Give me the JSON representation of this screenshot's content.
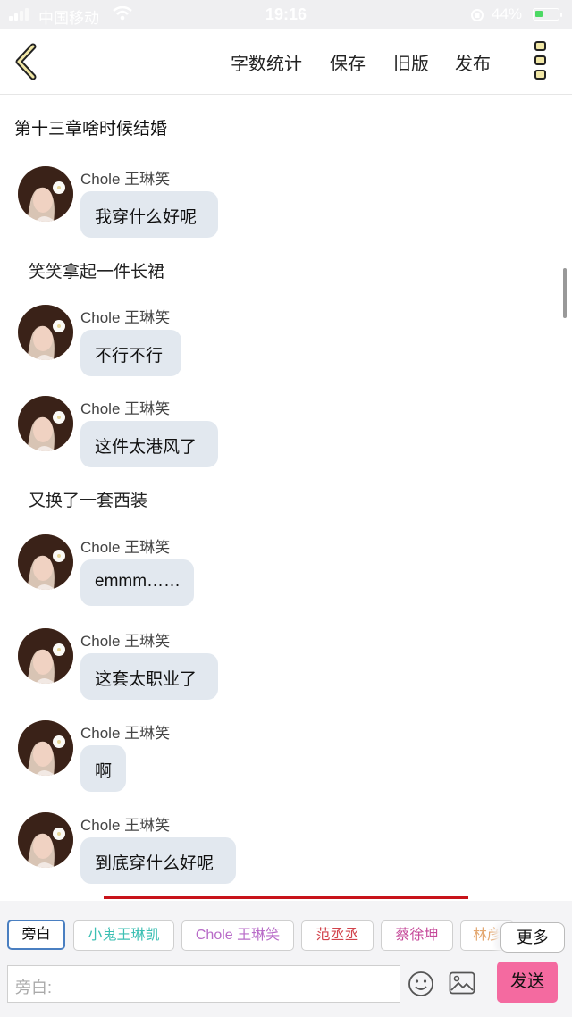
{
  "status_bar": {
    "carrier": "中国移动",
    "time": "19:16",
    "battery": "44%"
  },
  "toolbar": {
    "word_count": "字数统计",
    "save": "保存",
    "old_version": "旧版",
    "publish": "发布"
  },
  "chapter_title": "第十三章啥时候结婚",
  "messages": [
    {
      "type": "chat",
      "sender": "Chole 王琳笑",
      "text": "我穿什么好呢"
    },
    {
      "type": "narration",
      "text": "笑笑拿起一件长裙"
    },
    {
      "type": "chat",
      "sender": "Chole 王琳笑",
      "text": "不行不行"
    },
    {
      "type": "chat",
      "sender": "Chole 王琳笑",
      "text": "这件太港风了"
    },
    {
      "type": "narration",
      "text": "又换了一套西装"
    },
    {
      "type": "chat",
      "sender": "Chole 王琳笑",
      "text": "emmm……"
    },
    {
      "type": "chat",
      "sender": "Chole 王琳笑",
      "text": "这套太职业了"
    },
    {
      "type": "chat",
      "sender": "Chole 王琳笑",
      "text": "啊"
    },
    {
      "type": "chat",
      "sender": "Chole 王琳笑",
      "text": "到底穿什么好呢"
    }
  ],
  "roles": [
    {
      "label": "旁白",
      "color": "#111111",
      "selected": true
    },
    {
      "label": "小鬼王琳凯",
      "color": "#3bbfb3"
    },
    {
      "label": "Chole 王琳笑",
      "color": "#b86bc8"
    },
    {
      "label": "范丞丞",
      "color": "#d2434b"
    },
    {
      "label": "蔡徐坤",
      "color": "#c64a9a"
    },
    {
      "label": "林彦",
      "color": "#e3a76f"
    }
  ],
  "more_label": "更多",
  "input": {
    "placeholder": "旁白:"
  },
  "send_label": "发送",
  "colors": {
    "bubble": "#e2e8ef",
    "send": "#f46aa0",
    "accent": "#4a7fc1",
    "divider": "#c8131a"
  }
}
